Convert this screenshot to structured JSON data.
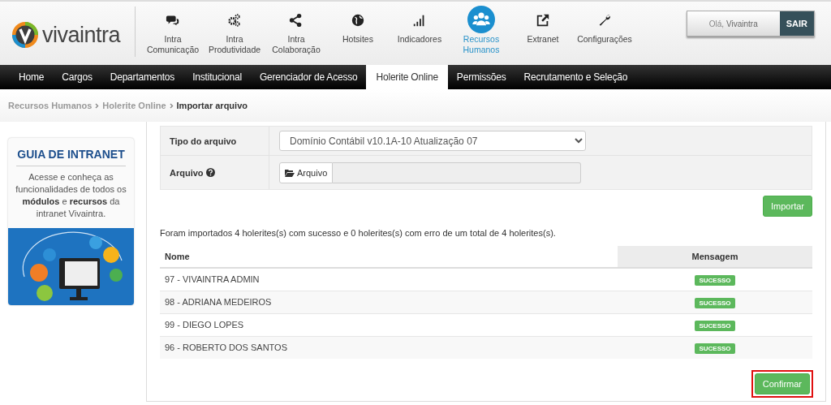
{
  "header": {
    "logo": "vivaintra",
    "modules": [
      {
        "label": "Intra Comunicação",
        "selected": false
      },
      {
        "label": "Intra Produtividade",
        "selected": false
      },
      {
        "label": "Intra Colaboração",
        "selected": false
      },
      {
        "label": "Hotsites",
        "selected": false
      },
      {
        "label": "Indicadores",
        "selected": false
      },
      {
        "label": "Recursos Humanos",
        "selected": true
      },
      {
        "label": "Extranet",
        "selected": false
      },
      {
        "label": "Configurações",
        "selected": false
      }
    ],
    "greeting": "Olá, **Vivaintra**",
    "logout": "SAIR"
  },
  "menu": [
    {
      "label": "Home",
      "selected": false
    },
    {
      "label": "Cargos",
      "selected": false
    },
    {
      "label": "Departamentos",
      "selected": false
    },
    {
      "label": "Institucional",
      "selected": false
    },
    {
      "label": "Gerenciador de Acesso",
      "selected": false
    },
    {
      "label": "Holerite Online",
      "selected": true
    },
    {
      "label": "Permissões",
      "selected": false
    },
    {
      "label": "Recrutamento e Seleção",
      "selected": false
    }
  ],
  "breadcrumb": [
    "Recursos Humanos",
    "Holerite Online",
    "Importar arquivo"
  ],
  "banner": {
    "title": "GUIA DE INTRANET",
    "text": "Acesse e conheça as funcionalidades de todos os **módulos** e **recursos** da intranet Vivaintra."
  },
  "form": {
    "fields": [
      {
        "kind": "select",
        "label": "Tipo do arquivo",
        "value": "Domínio Contábil v10.1A-10 Atualização 07"
      },
      {
        "kind": "file",
        "label": "Arquivo",
        "button": "Arquivo"
      }
    ],
    "submit": "Importar"
  },
  "result": {
    "message": "Foram importados 4 holerites(s) com sucesso e 0 holerites(s) com erro de um total de 4 holerites(s).",
    "columns": [
      "Nome",
      "Mensagem"
    ],
    "rows": [
      {
        "name": "97 - VIVAINTRA ADMIN",
        "status": "SUCESSO"
      },
      {
        "name": "98 - ADRIANA MEDEIROS",
        "status": "SUCESSO"
      },
      {
        "name": "99 - DIEGO LOPES",
        "status": "SUCESSO"
      },
      {
        "name": "96 - ROBERTO DOS SANTOS",
        "status": "SUCESSO"
      }
    ],
    "confirm": {
      "label": "Confirmar",
      "highlighted": true
    }
  }
}
